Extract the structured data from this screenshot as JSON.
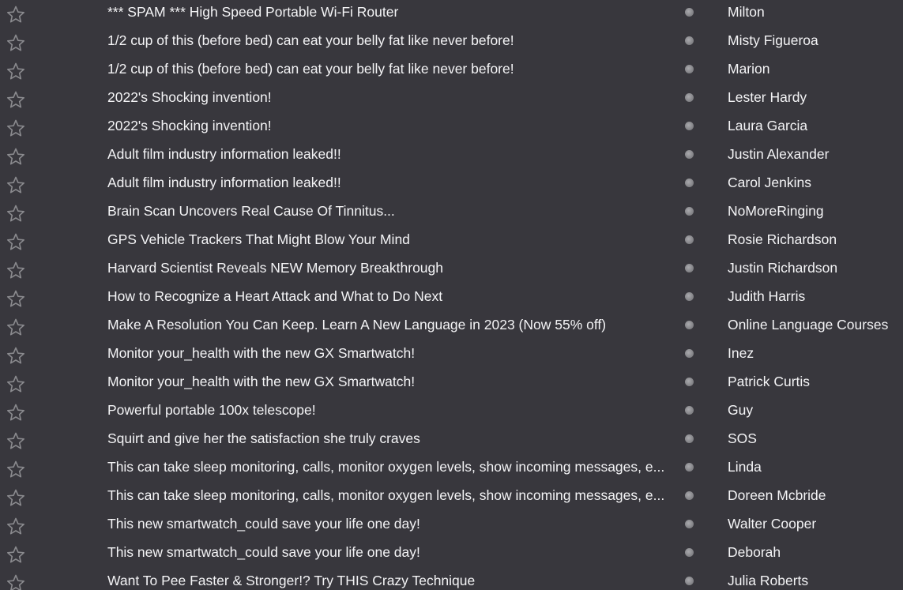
{
  "message_list": {
    "rows": [
      {
        "subject": "*** SPAM *** High Speed Portable Wi-Fi Router",
        "sender": "Milton",
        "starred": false,
        "read": true
      },
      {
        "subject": "1/2 cup of this (before bed) can eat your belly fat like never before!",
        "sender": "Misty Figueroa",
        "starred": false,
        "read": true
      },
      {
        "subject": "1/2 cup of this (before bed) can eat your belly fat like never before!",
        "sender": "Marion",
        "starred": false,
        "read": true
      },
      {
        "subject": "2022's Shocking invention!",
        "sender": "Lester Hardy",
        "starred": false,
        "read": true
      },
      {
        "subject": "2022's Shocking invention!",
        "sender": "Laura Garcia",
        "starred": false,
        "read": true
      },
      {
        "subject": "Adult film industry information leaked!!",
        "sender": "Justin Alexander",
        "starred": false,
        "read": true
      },
      {
        "subject": "Adult film industry information leaked!!",
        "sender": "Carol Jenkins",
        "starred": false,
        "read": true
      },
      {
        "subject": "Brain Scan Uncovers Real Cause Of Tinnitus...",
        "sender": "NoMoreRinging",
        "starred": false,
        "read": true
      },
      {
        "subject": "GPS Vehicle Trackers That Might Blow Your Mind",
        "sender": "Rosie Richardson",
        "starred": false,
        "read": true
      },
      {
        "subject": "Harvard Scientist Reveals NEW Memory Breakthrough",
        "sender": "Justin Richardson",
        "starred": false,
        "read": true
      },
      {
        "subject": "How to Recognize a Heart Attack and What to Do Next",
        "sender": "Judith Harris",
        "starred": false,
        "read": true
      },
      {
        "subject": "Make A Resolution You Can Keep. Learn A New Language in 2023 (Now 55% off)",
        "sender": "Online Language Courses",
        "starred": false,
        "read": true
      },
      {
        "subject": "Monitor your_health with the new GX Smartwatch!",
        "sender": "Inez",
        "starred": false,
        "read": true
      },
      {
        "subject": "Monitor your_health with the new GX Smartwatch!",
        "sender": "Patrick Curtis",
        "starred": false,
        "read": true
      },
      {
        "subject": "Powerful portable 100x telescope!",
        "sender": "Guy",
        "starred": false,
        "read": true
      },
      {
        "subject": "Squirt and give her the satisfaction she truly craves",
        "sender": "SOS",
        "starred": false,
        "read": true
      },
      {
        "subject": "This can take sleep monitoring, calls, monitor oxygen levels, show incoming messages, e...",
        "sender": "Linda",
        "starred": false,
        "read": true
      },
      {
        "subject": "This can take sleep monitoring, calls, monitor oxygen levels, show incoming messages, e...",
        "sender": "Doreen Mcbride",
        "starred": false,
        "read": true
      },
      {
        "subject": "This new smartwatch_could save your life one day!",
        "sender": "Walter Cooper",
        "starred": false,
        "read": true
      },
      {
        "subject": "This new smartwatch_could save your life one day!",
        "sender": "Deborah",
        "starred": false,
        "read": true
      },
      {
        "subject": "Want To Pee Faster & Stronger!? Try THIS Crazy Technique",
        "sender": "Julia Roberts",
        "starred": false,
        "read": true
      }
    ],
    "icons": {
      "star": "star-outline-icon",
      "read_status": "read-dot-icon"
    },
    "colors": {
      "background": "#38373d",
      "text": "#f4f4f6",
      "star_outline": "#8a8a8e",
      "read_dot": "#858589"
    }
  }
}
